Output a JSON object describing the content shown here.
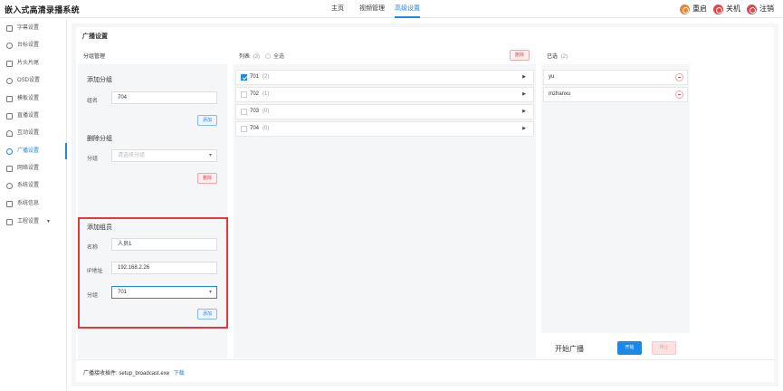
{
  "app": {
    "title": "嵌入式高清录播系统"
  },
  "nav": {
    "items": [
      "主页",
      "视频管理",
      "高级设置"
    ]
  },
  "top_actions": {
    "restart": "重启",
    "shutdown": "关机",
    "logout": "注销"
  },
  "colors": {
    "accent": "#1e88e5",
    "danger": "#e54545",
    "restart_icon": "#f5821f",
    "highlight_box": "#e03a3a"
  },
  "sidebar": {
    "items": [
      {
        "label": "字幕设置",
        "icon": "subtitle-icon"
      },
      {
        "label": "台标设置",
        "icon": "logo-icon"
      },
      {
        "label": "片头片尾",
        "icon": "film-icon"
      },
      {
        "label": "OSD设置",
        "icon": "osd-icon"
      },
      {
        "label": "模板设置",
        "icon": "template-icon"
      },
      {
        "label": "直播设置",
        "icon": "live-icon"
      },
      {
        "label": "互动设置",
        "icon": "interact-icon"
      },
      {
        "label": "广播设置",
        "icon": "broadcast-icon"
      },
      {
        "label": "网络设置",
        "icon": "network-icon"
      },
      {
        "label": "系统设置",
        "icon": "system-icon"
      },
      {
        "label": "系统信息",
        "icon": "info-icon"
      },
      {
        "label": "工程设置",
        "icon": "engineering-icon"
      }
    ],
    "active_index": 7
  },
  "panel": {
    "title": "广播设置"
  },
  "group_mgmt": {
    "header": "分组管理",
    "add_group": {
      "title": "添加分组",
      "name_label": "组名",
      "name_value": "704",
      "button": "添加"
    },
    "del_group": {
      "title": "删除分组",
      "group_label": "分组",
      "group_placeholder": "请选择分组",
      "button": "删除"
    },
    "add_member": {
      "title": "添加组员",
      "name_label": "名称",
      "name_value": "人员1",
      "ip_label": "IP地址",
      "ip_value": "192.168.2.26",
      "group_label": "分组",
      "group_value": "701",
      "button": "添加"
    }
  },
  "list": {
    "header": "列表",
    "count": "(3)",
    "select_all": "全选",
    "delete_button": "删除",
    "groups": [
      {
        "name": "701",
        "count": "(2)",
        "checked": true
      },
      {
        "name": "702",
        "count": "(1)",
        "checked": false
      },
      {
        "name": "703",
        "count": "(0)",
        "checked": false
      },
      {
        "name": "704",
        "count": "(0)",
        "checked": false
      }
    ]
  },
  "selected": {
    "header": "已选",
    "count": "(2)",
    "items": [
      "yu",
      "mzhanxu"
    ]
  },
  "broadcast": {
    "label": "开始广播",
    "start": "开始",
    "stop": "停止"
  },
  "footer": {
    "plugin_label": "广播接收插件: setup_broadcast.exe",
    "download_link": "下载"
  }
}
